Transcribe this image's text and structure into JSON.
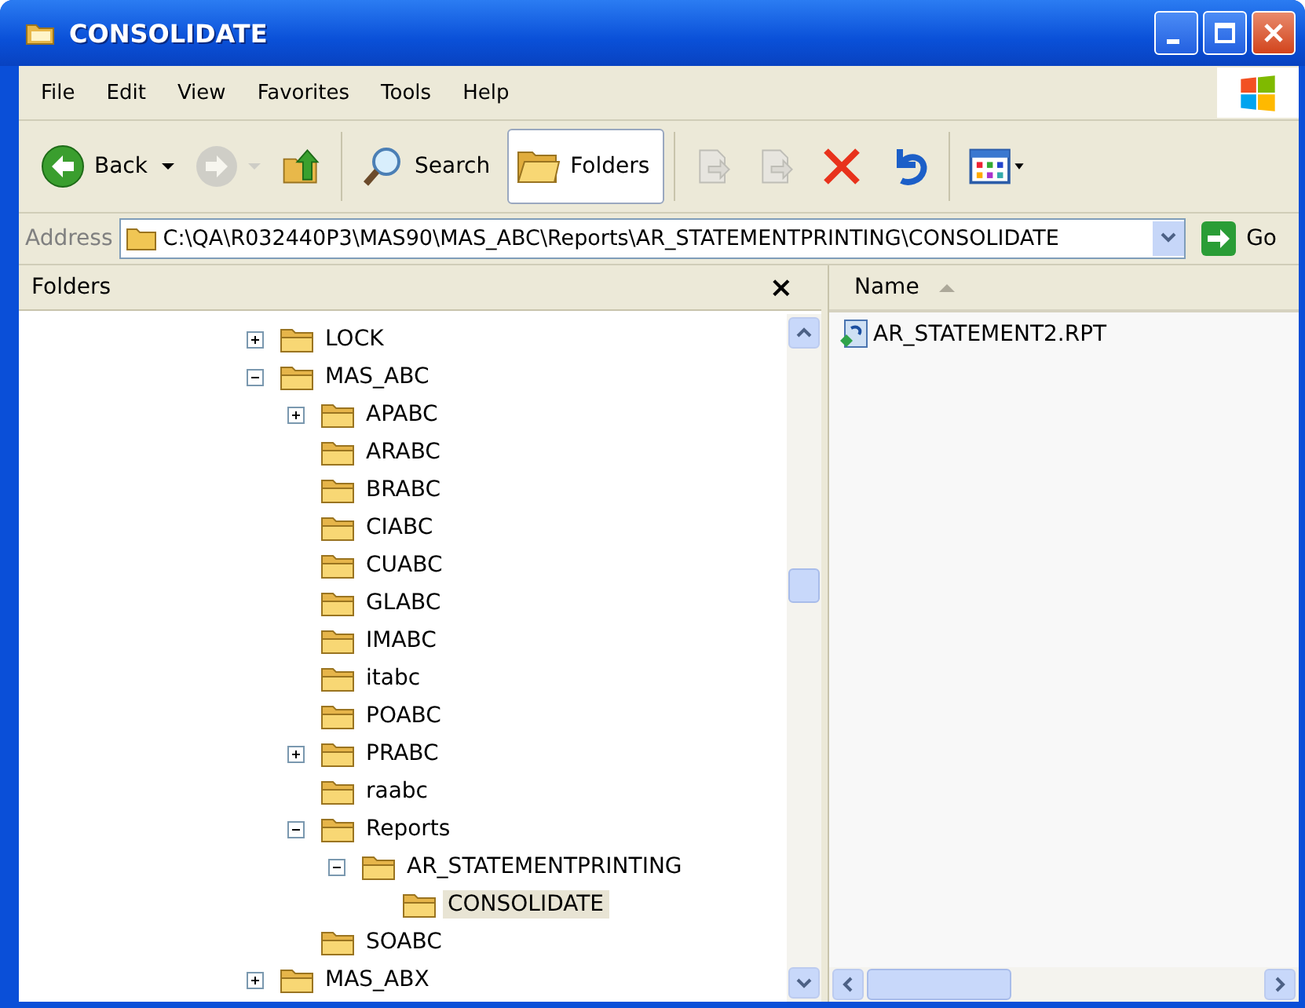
{
  "window": {
    "title": "CONSOLIDATE"
  },
  "menu": [
    "File",
    "Edit",
    "View",
    "Favorites",
    "Tools",
    "Help"
  ],
  "toolbar": [
    {
      "label": "Back",
      "disabled": false,
      "selected": false
    },
    {
      "disabled": true,
      "selected": false
    },
    {
      "disabled": false,
      "selected": false
    },
    {
      "label": "Search",
      "disabled": false,
      "selected": false
    },
    {
      "label": "Folders",
      "disabled": false,
      "selected": true
    },
    {
      "disabled": true,
      "selected": false
    },
    {
      "disabled": true,
      "selected": false
    },
    {
      "disabled": false,
      "selected": false
    },
    {
      "disabled": false,
      "selected": false
    },
    {
      "disabled": false,
      "selected": false
    }
  ],
  "address": {
    "label": "Address",
    "value": "C:\\QA\\R032440P3\\MAS90\\MAS_ABC\\Reports\\AR_STATEMENTPRINTING\\CONSOLIDATE",
    "go": "Go"
  },
  "folders_pane": {
    "title": "Folders",
    "close": "×",
    "tree": [
      {
        "name": "LOCK",
        "kind": "branch",
        "expanded": false,
        "selected": false
      },
      {
        "name": "MAS_ABC",
        "kind": "branch",
        "expanded": true,
        "selected": false,
        "children": [
          {
            "name": "APABC",
            "kind": "branch",
            "expanded": false,
            "selected": false
          },
          {
            "name": "ARABC",
            "kind": "leaf",
            "selected": false
          },
          {
            "name": "BRABC",
            "kind": "leaf",
            "selected": false
          },
          {
            "name": "CIABC",
            "kind": "leaf",
            "selected": false
          },
          {
            "name": "CUABC",
            "kind": "leaf",
            "selected": false
          },
          {
            "name": "GLABC",
            "kind": "leaf",
            "selected": false
          },
          {
            "name": "IMABC",
            "kind": "leaf",
            "selected": false
          },
          {
            "name": "itabc",
            "kind": "leaf",
            "selected": false
          },
          {
            "name": "POABC",
            "kind": "leaf",
            "selected": false
          },
          {
            "name": "PRABC",
            "kind": "branch",
            "expanded": false,
            "selected": false
          },
          {
            "name": "raabc",
            "kind": "leaf",
            "selected": false
          },
          {
            "name": "Reports",
            "kind": "branch",
            "expanded": true,
            "selected": false,
            "children": [
              {
                "name": "AR_STATEMENTPRINTING",
                "kind": "branch",
                "expanded": true,
                "selected": false,
                "children": [
                  {
                    "name": "CONSOLIDATE",
                    "kind": "leaf",
                    "selected": true
                  }
                ]
              }
            ]
          },
          {
            "name": "SOABC",
            "kind": "leaf",
            "selected": false
          }
        ]
      },
      {
        "name": "MAS_ABX",
        "kind": "branch",
        "expanded": false,
        "selected": false
      }
    ]
  },
  "file_list": {
    "columns": [
      "Name"
    ],
    "files": [
      {
        "name": "AR_STATEMENT2.RPT"
      }
    ]
  }
}
